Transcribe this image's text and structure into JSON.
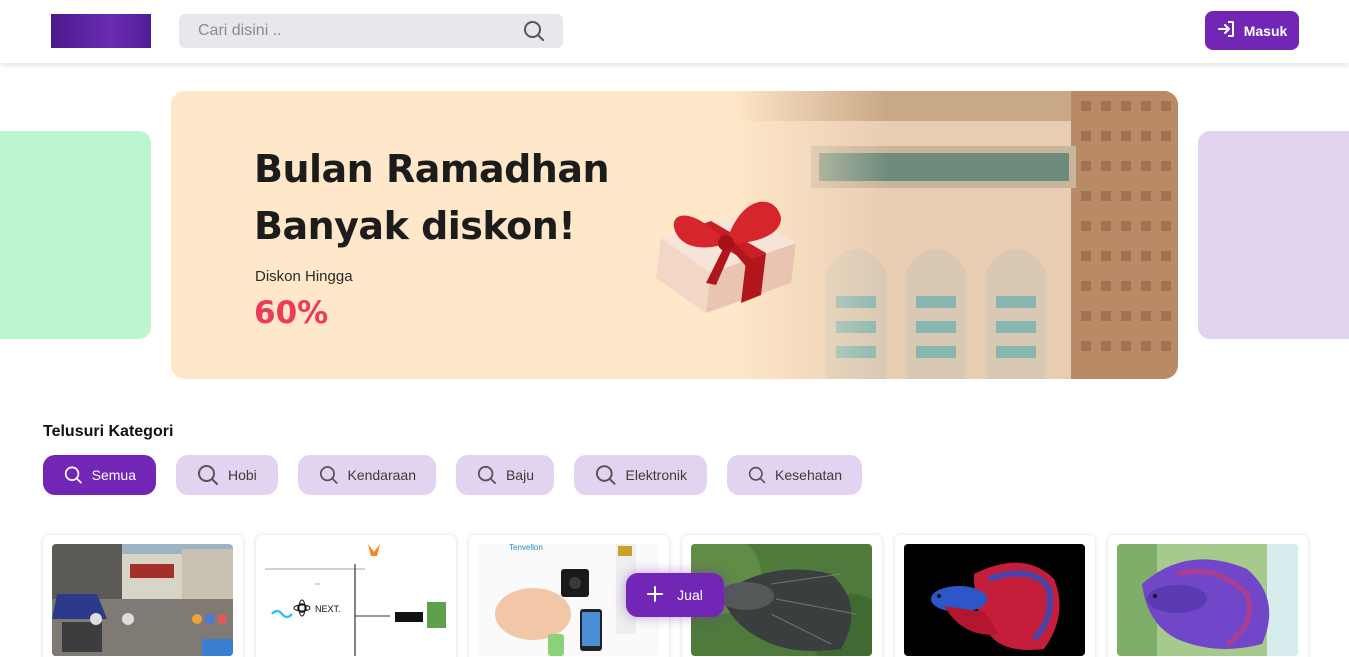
{
  "header": {
    "search_placeholder": "Cari disini ..",
    "login_label": "Masuk"
  },
  "banner": {
    "title_line1": "Bulan Ramadhan",
    "title_line2": "Banyak diskon!",
    "subtitle": "Diskon Hingga",
    "discount": "60%"
  },
  "categories": {
    "heading": "Telusuri Kategori",
    "items": [
      "Semua",
      "Hobi",
      "Kendaraan",
      "Baju",
      "Elektronik",
      "Kesehatan"
    ]
  },
  "products": [
    {
      "image": "storefront-photo"
    },
    {
      "image": "tech-stack-diagram",
      "caption": "NEXT."
    },
    {
      "image": "mini-camera-photo",
      "brand": "Tenvellon"
    },
    {
      "image": "betta-fish-dark"
    },
    {
      "image": "betta-fish-blue-red"
    },
    {
      "image": "betta-fish-purple"
    }
  ],
  "sell_button": {
    "label": "Jual"
  },
  "colors": {
    "primary": "#7126b5",
    "chip": "#e2d4f0",
    "banner": "#ffe7c9",
    "discount": "#ee3a5a"
  }
}
